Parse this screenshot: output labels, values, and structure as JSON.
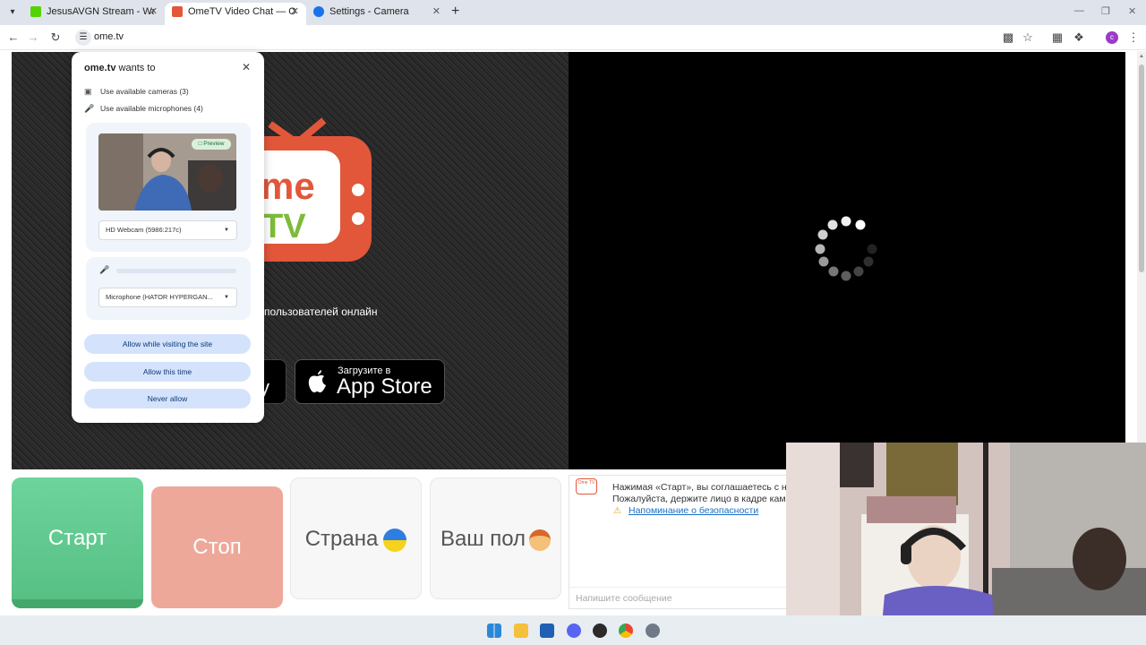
{
  "browser": {
    "tabs": [
      {
        "title": "JesusAVGN Stream - Watch Live on",
        "favicon_color": "#53d400"
      },
      {
        "title": "OmeTV Video Chat — Omegle",
        "favicon_color": "#e2573a"
      },
      {
        "title": "Settings - Camera",
        "favicon_color": "#1a73e8"
      }
    ],
    "url": "ome.tv",
    "profile_initial": "c"
  },
  "permission": {
    "site": "ome.tv",
    "wants_to": "wants to",
    "camera_text": "Use available cameras (3)",
    "mic_text": "Use available microphones (4)",
    "preview_badge": "Preview",
    "camera_select": "HD Webcam (5986:217c)",
    "mic_select": "Microphone (HATOR HYPERGAN...",
    "buttons": {
      "allow_visiting": "Allow while visiting the site",
      "allow_once": "Allow this time",
      "never": "Never allow"
    }
  },
  "page": {
    "logo_line1": "me",
    "logo_line2": "TV",
    "online_text": "пользователей онлайн",
    "gplay_partial": "y",
    "appstore_small": "Загрузите в",
    "appstore_big": "App Store",
    "buttons": {
      "start": "Старт",
      "stop": "Стоп",
      "country": "Страна",
      "gender": "Ваш пол"
    },
    "chat": {
      "logo": "Ome TV",
      "line1": "Нажимая «Старт», вы соглашаетесь с наш",
      "line2": "Пожалуйста, держите лицо в кадре камер",
      "safety_link": "Напоминание о безопасности",
      "placeholder": "Напишите сообщение"
    }
  },
  "colors": {
    "brand_red": "#e2573a",
    "brand_green": "#7dbb3a",
    "start_green": "#57c084",
    "stop_pink": "#eea89a"
  }
}
